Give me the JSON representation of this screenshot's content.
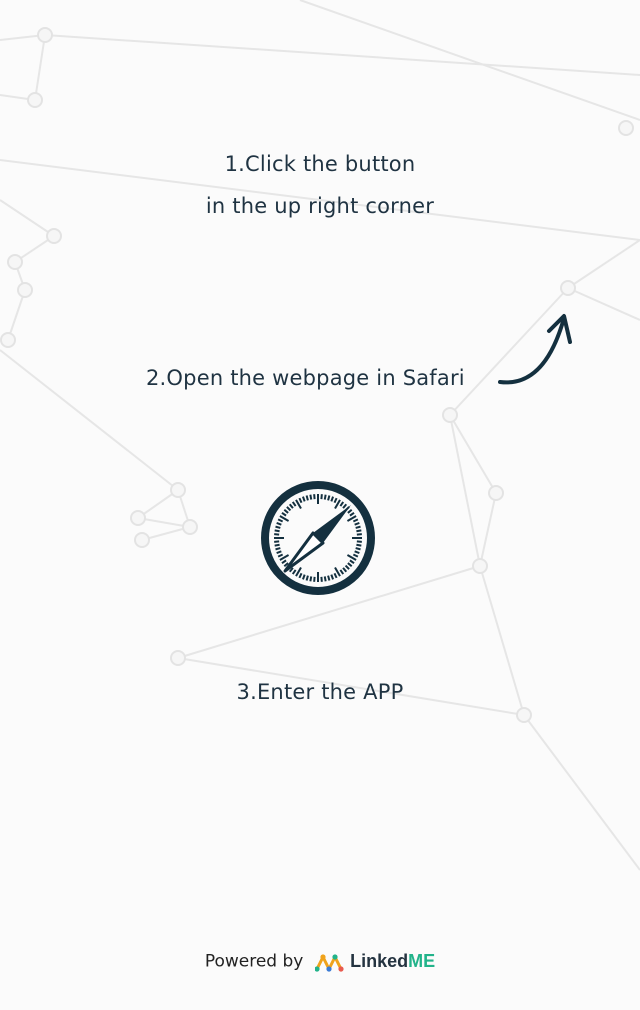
{
  "steps": {
    "step1_line1": "1.Click the button",
    "step1_line2": "in the up right corner",
    "step2": "2.Open the webpage in Safari",
    "step3": "3.Enter the APP"
  },
  "footer": {
    "powered_by": "Powered by",
    "brand_part1": "Linked",
    "brand_part2": "ME"
  },
  "icons": {
    "arrow": "curved-arrow-icon",
    "safari": "safari-compass-icon",
    "logo": "linkedme-logo-icon"
  },
  "colors": {
    "text": "#1f3342",
    "icon": "#14303f",
    "brand_accent": "#22b38a",
    "background": "#fbfbfb"
  }
}
